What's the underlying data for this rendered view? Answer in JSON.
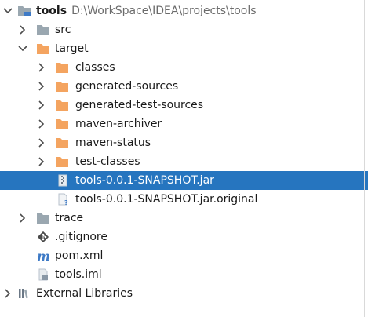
{
  "project_tree": {
    "root": {
      "name": "tools",
      "path": "D:\\WorkSpace\\IDEA\\projects\\tools",
      "expanded": true
    },
    "items": [
      {
        "label": "src",
        "type": "folder",
        "icon": "folder-icon",
        "expanded": false
      },
      {
        "label": "target",
        "type": "folder",
        "icon": "folder-icon",
        "expanded": true
      },
      {
        "label": "classes",
        "type": "folder",
        "icon": "folder-icon",
        "expanded": false
      },
      {
        "label": "generated-sources",
        "type": "folder",
        "icon": "folder-icon",
        "expanded": false
      },
      {
        "label": "generated-test-sources",
        "type": "folder",
        "icon": "folder-icon",
        "expanded": false
      },
      {
        "label": "maven-archiver",
        "type": "folder",
        "icon": "folder-icon",
        "expanded": false
      },
      {
        "label": "maven-status",
        "type": "folder",
        "icon": "folder-icon",
        "expanded": false
      },
      {
        "label": "test-classes",
        "type": "folder",
        "icon": "folder-icon",
        "expanded": false
      },
      {
        "label": "tools-0.0.1-SNAPSHOT.jar",
        "type": "file",
        "icon": "jar-icon",
        "selected": true
      },
      {
        "label": "tools-0.0.1-SNAPSHOT.jar.original",
        "type": "file",
        "icon": "unknown-file-icon"
      },
      {
        "label": "trace",
        "type": "folder",
        "icon": "folder-icon",
        "expanded": false
      },
      {
        "label": ".gitignore",
        "type": "file",
        "icon": "git-icon"
      },
      {
        "label": "pom.xml",
        "type": "file",
        "icon": "maven-icon"
      },
      {
        "label": "tools.iml",
        "type": "file",
        "icon": "iml-icon"
      }
    ],
    "external_libraries": {
      "label": "External Libraries",
      "icon": "libraries-icon",
      "expanded": false
    }
  },
  "colors": {
    "selection": "#2675bf",
    "folder": "#f4a460",
    "folder_gray": "#9aa7b0",
    "path_text": "#6b6b6b",
    "arrow": "#4d4d4d"
  }
}
